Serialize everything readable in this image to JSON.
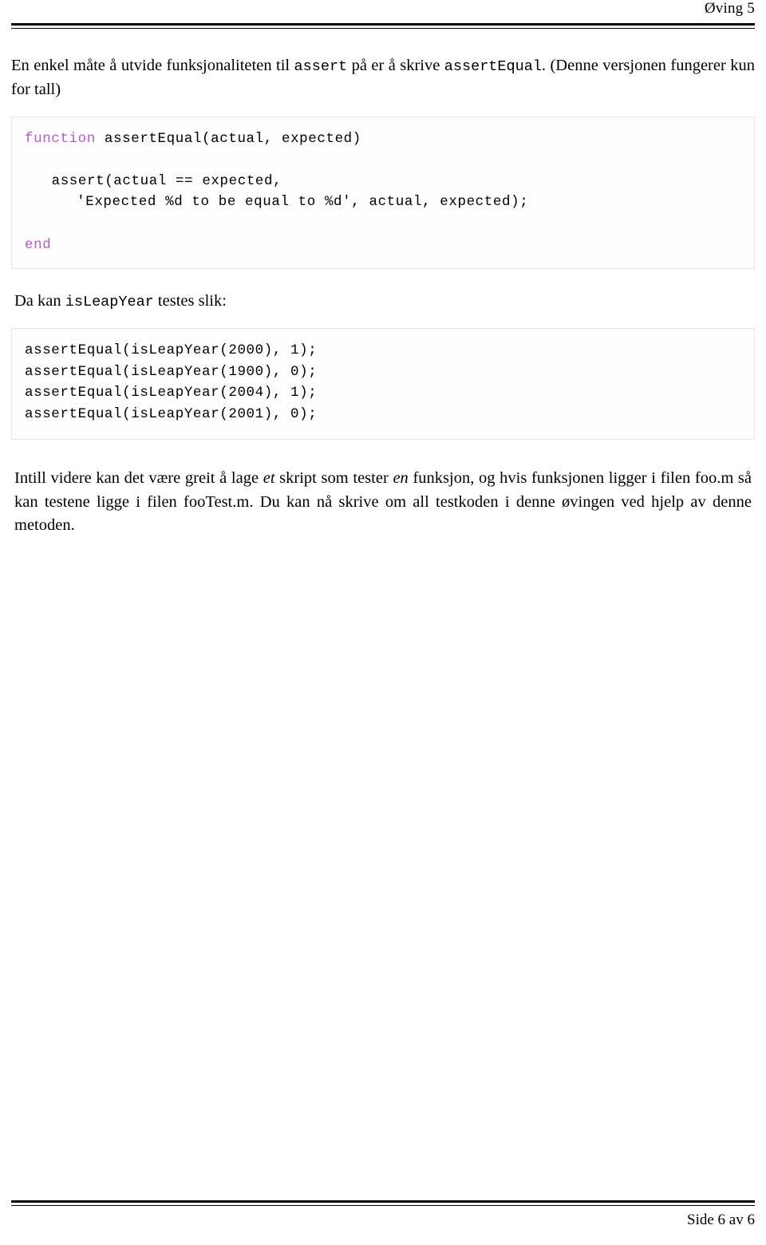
{
  "header": {
    "title": "Øving 5"
  },
  "intro": {
    "part1": "En enkel måte å utvide funksjonaliteten til ",
    "code1": "assert",
    "part2": " på er å skrive ",
    "code2": "assertEqual",
    "part3": ". (Denne versjonen fungerer kun for tall)"
  },
  "code_block_1": {
    "lines": [
      {
        "keyword": "function",
        "rest": " assertEqual(actual, expected)",
        "indent": 0
      },
      {
        "keyword": "",
        "rest": "",
        "indent": 0
      },
      {
        "keyword": "",
        "rest": "assert(actual == expected,",
        "indent": 1
      },
      {
        "keyword": "",
        "rest": "'Expected %d to be equal to %d', actual, expected);",
        "indent": 2
      },
      {
        "keyword": "",
        "rest": "",
        "indent": 0
      },
      {
        "keyword": "end",
        "rest": "",
        "indent": 0
      }
    ]
  },
  "mid_text": {
    "part1": "Da kan ",
    "code1": "isLeapYear",
    "part2": " testes slik:"
  },
  "code_block_2": {
    "lines": [
      "assertEqual(isLeapYear(2000), 1);",
      "assertEqual(isLeapYear(1900), 0);",
      "assertEqual(isLeapYear(2004), 1);",
      "assertEqual(isLeapYear(2001), 0);"
    ]
  },
  "tail_text": {
    "part1": "Intill videre kan det være greit å lage ",
    "em1": "et",
    "part2": " skript som tester ",
    "em2": "en",
    "part3": " funksjon, og hvis funksjonen ligger i filen foo.m så kan testene ligge i filen fooTest.m. Du kan nå skrive om all testkoden i denne øvingen ved hjelp av denne metoden."
  },
  "footer": {
    "page_label": "Side 6 av 6"
  },
  "colors": {
    "keyword": "#b05ec4",
    "rule": "#000000",
    "code_border": "#e6e6e6"
  }
}
